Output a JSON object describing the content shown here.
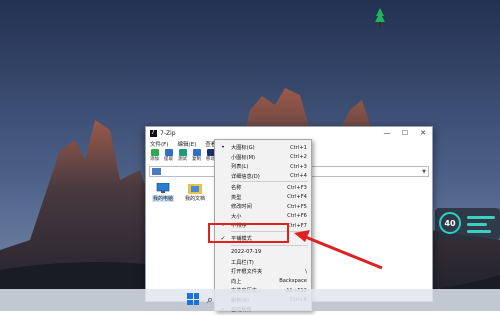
{
  "window": {
    "title": "7-Zip",
    "controls": [
      "—",
      "☐",
      "✕"
    ]
  },
  "menubar": [
    "文件(F)",
    "编辑(E)",
    "查看(V)"
  ],
  "toolbar": [
    {
      "label": "添加",
      "color": "#2fa84f"
    },
    {
      "label": "提取",
      "color": "#2f6fc9"
    },
    {
      "label": "测试",
      "color": "#1c9b7a"
    },
    {
      "label": "复制",
      "color": "#2f6fc9"
    },
    {
      "label": "移动",
      "color": "#1b2f6b"
    }
  ],
  "address": {
    "path": "",
    "dropdown": "▼"
  },
  "items": [
    {
      "label": "我的电脑",
      "icon": "computer-icon"
    },
    {
      "label": "我的文档",
      "icon": "documents-folder-icon"
    }
  ],
  "context_menu": [
    {
      "label": "大图标(G)",
      "shortcut": "Ctrl+1",
      "mark": "•"
    },
    {
      "label": "小图标(M)",
      "shortcut": "Ctrl+2",
      "mark": ""
    },
    {
      "label": "列表(L)",
      "shortcut": "Ctrl+3",
      "mark": ""
    },
    {
      "label": "详细信息(D)",
      "shortcut": "Ctrl+4",
      "mark": ""
    },
    {
      "label": "名称",
      "shortcut": "Ctrl+F3",
      "mark": ""
    },
    {
      "label": "类型",
      "shortcut": "Ctrl+F4",
      "mark": ""
    },
    {
      "label": "修改时间",
      "shortcut": "Ctrl+F5",
      "mark": ""
    },
    {
      "label": "大小",
      "shortcut": "Ctrl+F6",
      "mark": ""
    },
    {
      "label": "不排序",
      "shortcut": "Ctrl+F7",
      "mark": "•"
    },
    {
      "label": "平铺模式",
      "shortcut": "",
      "mark": "✓"
    },
    {
      "label": "2022-07-19",
      "shortcut": "",
      "mark": ""
    },
    {
      "label": "工具栏(T)",
      "shortcut": "",
      "mark": ""
    },
    {
      "label": "打开根文件夹",
      "shortcut": "\\",
      "mark": ""
    },
    {
      "label": "向上",
      "shortcut": "Backspace",
      "mark": ""
    },
    {
      "label": "文件夹历史...",
      "shortcut": "Alt+F12",
      "mark": ""
    },
    {
      "label": "刷新(R)",
      "shortcut": "Ctrl+R",
      "mark": ""
    },
    {
      "label": "自动刷新",
      "shortcut": "",
      "mark": "✓"
    }
  ],
  "widget": {
    "value": "40",
    "accent": "#2ad1c0"
  },
  "colors": {
    "highlight": "#e02020",
    "sky": "#2a3a5c"
  }
}
